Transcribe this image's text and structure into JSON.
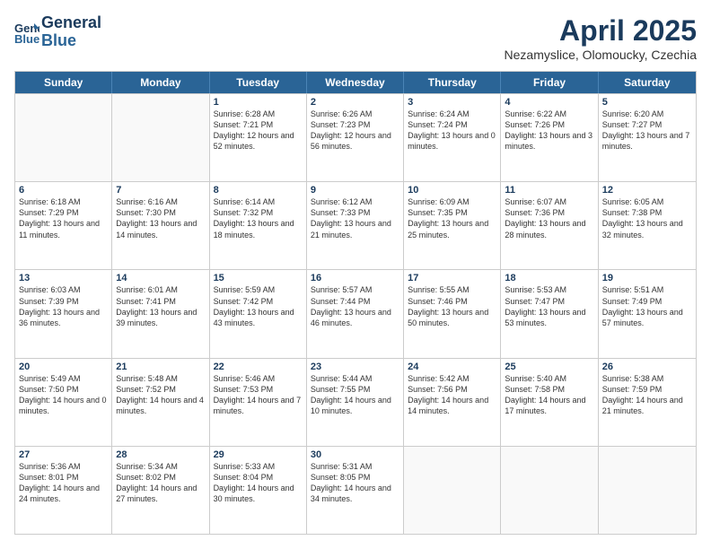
{
  "header": {
    "logo_line1": "General",
    "logo_line2": "Blue",
    "month": "April 2025",
    "location": "Nezamyslice, Olomoucky, Czechia"
  },
  "weekdays": [
    "Sunday",
    "Monday",
    "Tuesday",
    "Wednesday",
    "Thursday",
    "Friday",
    "Saturday"
  ],
  "weeks": [
    [
      {
        "day": "",
        "sunrise": "",
        "sunset": "",
        "daylight": ""
      },
      {
        "day": "",
        "sunrise": "",
        "sunset": "",
        "daylight": ""
      },
      {
        "day": "1",
        "sunrise": "Sunrise: 6:28 AM",
        "sunset": "Sunset: 7:21 PM",
        "daylight": "Daylight: 12 hours and 52 minutes."
      },
      {
        "day": "2",
        "sunrise": "Sunrise: 6:26 AM",
        "sunset": "Sunset: 7:23 PM",
        "daylight": "Daylight: 12 hours and 56 minutes."
      },
      {
        "day": "3",
        "sunrise": "Sunrise: 6:24 AM",
        "sunset": "Sunset: 7:24 PM",
        "daylight": "Daylight: 13 hours and 0 minutes."
      },
      {
        "day": "4",
        "sunrise": "Sunrise: 6:22 AM",
        "sunset": "Sunset: 7:26 PM",
        "daylight": "Daylight: 13 hours and 3 minutes."
      },
      {
        "day": "5",
        "sunrise": "Sunrise: 6:20 AM",
        "sunset": "Sunset: 7:27 PM",
        "daylight": "Daylight: 13 hours and 7 minutes."
      }
    ],
    [
      {
        "day": "6",
        "sunrise": "Sunrise: 6:18 AM",
        "sunset": "Sunset: 7:29 PM",
        "daylight": "Daylight: 13 hours and 11 minutes."
      },
      {
        "day": "7",
        "sunrise": "Sunrise: 6:16 AM",
        "sunset": "Sunset: 7:30 PM",
        "daylight": "Daylight: 13 hours and 14 minutes."
      },
      {
        "day": "8",
        "sunrise": "Sunrise: 6:14 AM",
        "sunset": "Sunset: 7:32 PM",
        "daylight": "Daylight: 13 hours and 18 minutes."
      },
      {
        "day": "9",
        "sunrise": "Sunrise: 6:12 AM",
        "sunset": "Sunset: 7:33 PM",
        "daylight": "Daylight: 13 hours and 21 minutes."
      },
      {
        "day": "10",
        "sunrise": "Sunrise: 6:09 AM",
        "sunset": "Sunset: 7:35 PM",
        "daylight": "Daylight: 13 hours and 25 minutes."
      },
      {
        "day": "11",
        "sunrise": "Sunrise: 6:07 AM",
        "sunset": "Sunset: 7:36 PM",
        "daylight": "Daylight: 13 hours and 28 minutes."
      },
      {
        "day": "12",
        "sunrise": "Sunrise: 6:05 AM",
        "sunset": "Sunset: 7:38 PM",
        "daylight": "Daylight: 13 hours and 32 minutes."
      }
    ],
    [
      {
        "day": "13",
        "sunrise": "Sunrise: 6:03 AM",
        "sunset": "Sunset: 7:39 PM",
        "daylight": "Daylight: 13 hours and 36 minutes."
      },
      {
        "day": "14",
        "sunrise": "Sunrise: 6:01 AM",
        "sunset": "Sunset: 7:41 PM",
        "daylight": "Daylight: 13 hours and 39 minutes."
      },
      {
        "day": "15",
        "sunrise": "Sunrise: 5:59 AM",
        "sunset": "Sunset: 7:42 PM",
        "daylight": "Daylight: 13 hours and 43 minutes."
      },
      {
        "day": "16",
        "sunrise": "Sunrise: 5:57 AM",
        "sunset": "Sunset: 7:44 PM",
        "daylight": "Daylight: 13 hours and 46 minutes."
      },
      {
        "day": "17",
        "sunrise": "Sunrise: 5:55 AM",
        "sunset": "Sunset: 7:46 PM",
        "daylight": "Daylight: 13 hours and 50 minutes."
      },
      {
        "day": "18",
        "sunrise": "Sunrise: 5:53 AM",
        "sunset": "Sunset: 7:47 PM",
        "daylight": "Daylight: 13 hours and 53 minutes."
      },
      {
        "day": "19",
        "sunrise": "Sunrise: 5:51 AM",
        "sunset": "Sunset: 7:49 PM",
        "daylight": "Daylight: 13 hours and 57 minutes."
      }
    ],
    [
      {
        "day": "20",
        "sunrise": "Sunrise: 5:49 AM",
        "sunset": "Sunset: 7:50 PM",
        "daylight": "Daylight: 14 hours and 0 minutes."
      },
      {
        "day": "21",
        "sunrise": "Sunrise: 5:48 AM",
        "sunset": "Sunset: 7:52 PM",
        "daylight": "Daylight: 14 hours and 4 minutes."
      },
      {
        "day": "22",
        "sunrise": "Sunrise: 5:46 AM",
        "sunset": "Sunset: 7:53 PM",
        "daylight": "Daylight: 14 hours and 7 minutes."
      },
      {
        "day": "23",
        "sunrise": "Sunrise: 5:44 AM",
        "sunset": "Sunset: 7:55 PM",
        "daylight": "Daylight: 14 hours and 10 minutes."
      },
      {
        "day": "24",
        "sunrise": "Sunrise: 5:42 AM",
        "sunset": "Sunset: 7:56 PM",
        "daylight": "Daylight: 14 hours and 14 minutes."
      },
      {
        "day": "25",
        "sunrise": "Sunrise: 5:40 AM",
        "sunset": "Sunset: 7:58 PM",
        "daylight": "Daylight: 14 hours and 17 minutes."
      },
      {
        "day": "26",
        "sunrise": "Sunrise: 5:38 AM",
        "sunset": "Sunset: 7:59 PM",
        "daylight": "Daylight: 14 hours and 21 minutes."
      }
    ],
    [
      {
        "day": "27",
        "sunrise": "Sunrise: 5:36 AM",
        "sunset": "Sunset: 8:01 PM",
        "daylight": "Daylight: 14 hours and 24 minutes."
      },
      {
        "day": "28",
        "sunrise": "Sunrise: 5:34 AM",
        "sunset": "Sunset: 8:02 PM",
        "daylight": "Daylight: 14 hours and 27 minutes."
      },
      {
        "day": "29",
        "sunrise": "Sunrise: 5:33 AM",
        "sunset": "Sunset: 8:04 PM",
        "daylight": "Daylight: 14 hours and 30 minutes."
      },
      {
        "day": "30",
        "sunrise": "Sunrise: 5:31 AM",
        "sunset": "Sunset: 8:05 PM",
        "daylight": "Daylight: 14 hours and 34 minutes."
      },
      {
        "day": "",
        "sunrise": "",
        "sunset": "",
        "daylight": ""
      },
      {
        "day": "",
        "sunrise": "",
        "sunset": "",
        "daylight": ""
      },
      {
        "day": "",
        "sunrise": "",
        "sunset": "",
        "daylight": ""
      }
    ]
  ]
}
